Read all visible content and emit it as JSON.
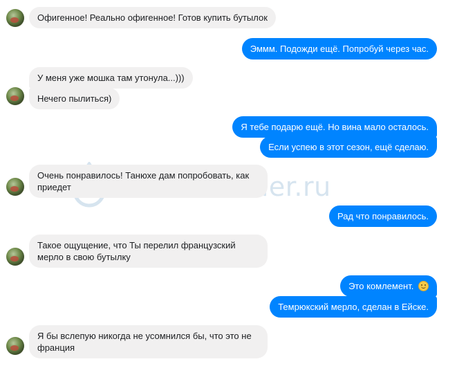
{
  "watermark": {
    "text": "HomeDistiller.ru"
  },
  "messages": [
    {
      "text": "Офигенное! Реально офигенное! Готов купить бутылок"
    },
    {
      "text": "Эммм. Подожди ещё. Попробуй через час."
    },
    {
      "text": "У меня уже мошка там утонула...)))"
    },
    {
      "text": "Нечего пылиться)"
    },
    {
      "text": "Я тебе подарю ещё. Но вина мало осталось."
    },
    {
      "text": "Если успею в этот сезон, ещё сделаю."
    },
    {
      "text": "Очень понравилось! Танюхе дам попробовать, как приедет"
    },
    {
      "text": "Рад что понравилось."
    },
    {
      "text": "Такое ощущение, что Ты перелил французский мерло в свою бутылку"
    },
    {
      "text": "Это комлемент."
    },
    {
      "text": "Темрюкский мерло, сделан в Ейске."
    },
    {
      "text": "Я бы вслепую никогда не усомнился бы, что это не франция"
    }
  ],
  "colors": {
    "outgoing_bubble": "#0084ff",
    "incoming_bubble": "#f1f0f0",
    "watermark": "#c9dbea"
  },
  "icons": [
    "avatar",
    "smiley-emoji-icon",
    "water-drop-icon"
  ]
}
